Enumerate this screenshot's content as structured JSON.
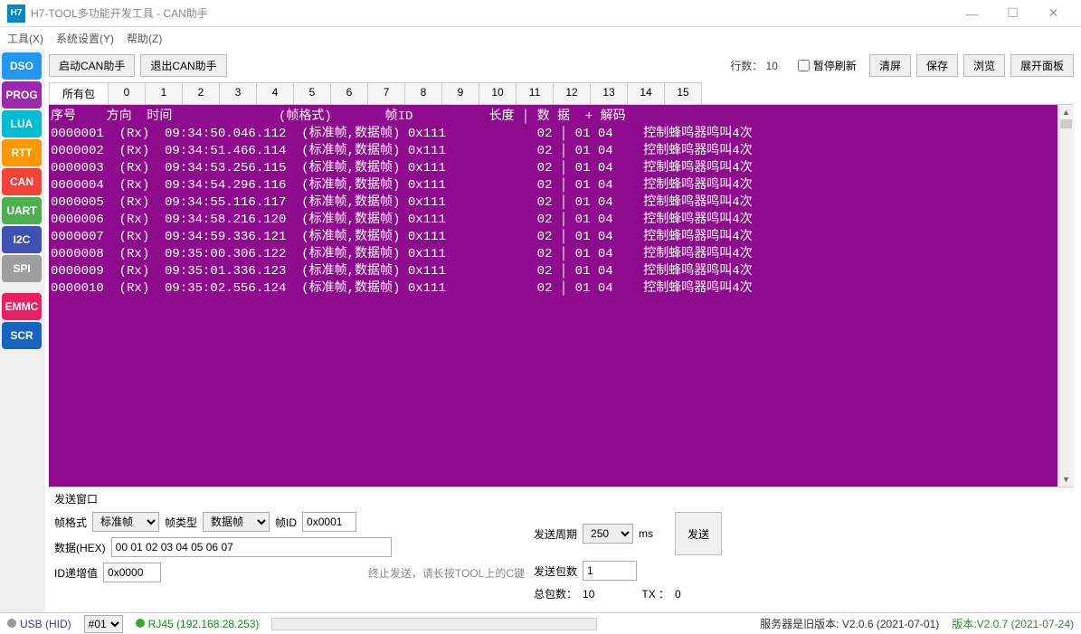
{
  "window": {
    "icon_text": "H7",
    "title": "H7-TOOL多功能开发工具 - CAN助手"
  },
  "menu": {
    "tools": "工具(X)",
    "sys": "系统设置(Y)",
    "help": "帮助(Z)"
  },
  "sidebar": {
    "items": [
      {
        "id": "dso",
        "label": "DSO"
      },
      {
        "id": "prog",
        "label": "PROG"
      },
      {
        "id": "lua",
        "label": "LUA"
      },
      {
        "id": "rtt",
        "label": "RTT"
      },
      {
        "id": "can",
        "label": "CAN"
      },
      {
        "id": "uart",
        "label": "UART"
      },
      {
        "id": "i2c",
        "label": "I2C"
      },
      {
        "id": "spi",
        "label": "SPI"
      },
      {
        "id": "emmc",
        "label": "EMMC"
      },
      {
        "id": "scr",
        "label": "SCR"
      }
    ]
  },
  "toolbar": {
    "start": "启动CAN助手",
    "exit": "退出CAN助手",
    "rows_label": "行数：",
    "rows_value": "10",
    "pause_label": "暂停刷新",
    "clear": "清屏",
    "save": "保存",
    "browse": "浏览",
    "expand": "展开面板"
  },
  "tabs": {
    "all": "所有包",
    "nums": [
      "0",
      "1",
      "2",
      "3",
      "4",
      "5",
      "6",
      "7",
      "8",
      "9",
      "10",
      "11",
      "12",
      "13",
      "14",
      "15"
    ]
  },
  "header_line": "序号    方向  时间              (帧格式)       帧ID          长度 │ 数 据  + 解码",
  "rows": [
    {
      "seq": "0000001",
      "dir": "(Rx)",
      "time": "09:34:50.046.112",
      "fmt": "(标准帧,数据帧)",
      "id": "0x111",
      "len": "02",
      "data": "01 04",
      "decode": "控制蜂鸣器鸣叫4次"
    },
    {
      "seq": "0000002",
      "dir": "(Rx)",
      "time": "09:34:51.466.114",
      "fmt": "(标准帧,数据帧)",
      "id": "0x111",
      "len": "02",
      "data": "01 04",
      "decode": "控制蜂鸣器鸣叫4次"
    },
    {
      "seq": "0000003",
      "dir": "(Rx)",
      "time": "09:34:53.256.115",
      "fmt": "(标准帧,数据帧)",
      "id": "0x111",
      "len": "02",
      "data": "01 04",
      "decode": "控制蜂鸣器鸣叫4次"
    },
    {
      "seq": "0000004",
      "dir": "(Rx)",
      "time": "09:34:54.296.116",
      "fmt": "(标准帧,数据帧)",
      "id": "0x111",
      "len": "02",
      "data": "01 04",
      "decode": "控制蜂鸣器鸣叫4次"
    },
    {
      "seq": "0000005",
      "dir": "(Rx)",
      "time": "09:34:55.116.117",
      "fmt": "(标准帧,数据帧)",
      "id": "0x111",
      "len": "02",
      "data": "01 04",
      "decode": "控制蜂鸣器鸣叫4次"
    },
    {
      "seq": "0000006",
      "dir": "(Rx)",
      "time": "09:34:58.216.120",
      "fmt": "(标准帧,数据帧)",
      "id": "0x111",
      "len": "02",
      "data": "01 04",
      "decode": "控制蜂鸣器鸣叫4次"
    },
    {
      "seq": "0000007",
      "dir": "(Rx)",
      "time": "09:34:59.336.121",
      "fmt": "(标准帧,数据帧)",
      "id": "0x111",
      "len": "02",
      "data": "01 04",
      "decode": "控制蜂鸣器鸣叫4次"
    },
    {
      "seq": "0000008",
      "dir": "(Rx)",
      "time": "09:35:00.306.122",
      "fmt": "(标准帧,数据帧)",
      "id": "0x111",
      "len": "02",
      "data": "01 04",
      "decode": "控制蜂鸣器鸣叫4次"
    },
    {
      "seq": "0000009",
      "dir": "(Rx)",
      "time": "09:35:01.336.123",
      "fmt": "(标准帧,数据帧)",
      "id": "0x111",
      "len": "02",
      "data": "01 04",
      "decode": "控制蜂鸣器鸣叫4次"
    },
    {
      "seq": "0000010",
      "dir": "(Rx)",
      "time": "09:35:02.556.124",
      "fmt": "(标准帧,数据帧)",
      "id": "0x111",
      "len": "02",
      "data": "01 04",
      "decode": "控制蜂鸣器鸣叫4次"
    }
  ],
  "send": {
    "title": "发送窗口",
    "frame_fmt_label": "帧格式",
    "frame_fmt_value": "标准帧",
    "frame_type_label": "帧类型",
    "frame_type_value": "数据帧",
    "frame_id_label": "帧ID",
    "frame_id_value": "0x0001",
    "period_label": "发送周期",
    "period_value": "250",
    "period_unit": "ms",
    "data_label": "数据(HEX)",
    "data_value": "00 01 02 03 04 05 06 07",
    "count_label": "发送包数",
    "count_value": "1",
    "idinc_label": "ID递增值",
    "idinc_value": "0x0000",
    "hint": "终止发送，请长按TOOL上的C键",
    "total_label": "总包数：",
    "total_value": "10",
    "tx_label": "TX ：",
    "tx_value": "0",
    "send_btn": "发送"
  },
  "status": {
    "usb": "USB (HID)",
    "sel": "#01",
    "rj45": "RJ45 (192.168.28.253)",
    "server": "服务器是旧版本: V2.0.6 (2021-07-01)",
    "version": "版本:V2.0.7 (2021-07-24)"
  }
}
